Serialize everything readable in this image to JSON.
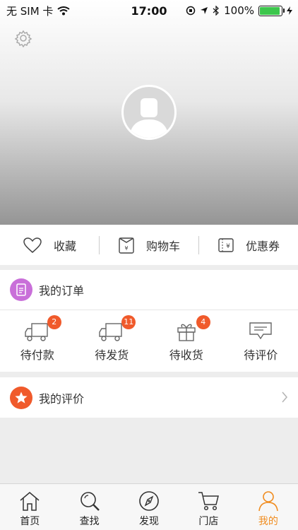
{
  "status_bar": {
    "carrier": "无 SIM 卡",
    "time": "17:00",
    "battery": "100%"
  },
  "quick_links": [
    {
      "label": "收藏",
      "icon": "heart-icon"
    },
    {
      "label": "购物车",
      "icon": "cart-bag-icon"
    },
    {
      "label": "优惠券",
      "icon": "coupon-icon"
    }
  ],
  "orders": {
    "title": "我的订单",
    "items": [
      {
        "label": "待付款",
        "badge": "2",
        "icon": "truck-icon"
      },
      {
        "label": "待发货",
        "badge": "11",
        "icon": "truck-icon"
      },
      {
        "label": "待收货",
        "badge": "4",
        "icon": "gift-icon"
      },
      {
        "label": "待评价",
        "badge": "",
        "icon": "comment-icon"
      }
    ]
  },
  "review": {
    "title": "我的评价"
  },
  "tabs": [
    {
      "label": "首页",
      "icon": "home-icon"
    },
    {
      "label": "查找",
      "icon": "search-icon"
    },
    {
      "label": "发现",
      "icon": "compass-icon"
    },
    {
      "label": "门店",
      "icon": "cart-icon"
    },
    {
      "label": "我的",
      "icon": "user-icon"
    }
  ],
  "colors": {
    "accent": "#f08c1f",
    "badge": "#f05a2b",
    "order_icon": "#c96fd9",
    "review_icon": "#f05a2b"
  }
}
